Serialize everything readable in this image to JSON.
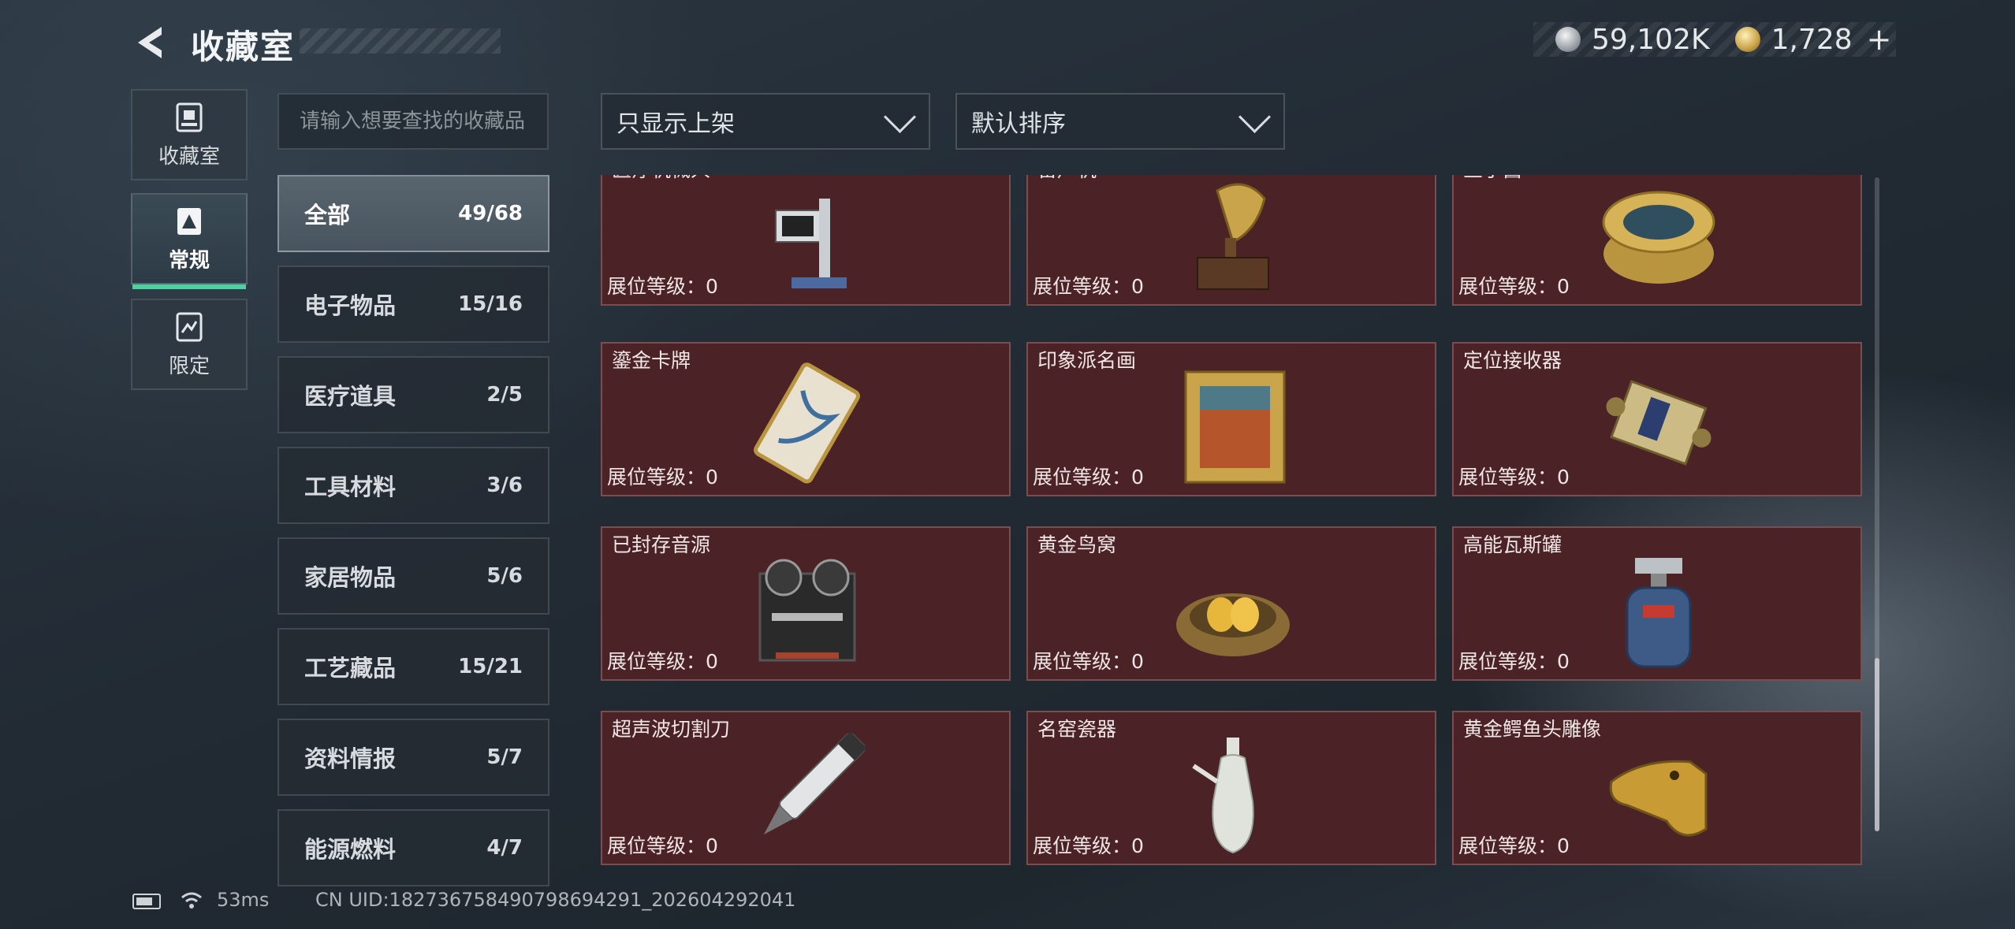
{
  "header": {
    "title": "收藏室"
  },
  "currency": [
    {
      "icon": "silver-coin-icon",
      "value": "59,102K"
    },
    {
      "icon": "gold-coin-icon",
      "value": "1,728"
    }
  ],
  "side_tabs": [
    {
      "label": "收藏室",
      "icon": "collection-room-icon",
      "active": false
    },
    {
      "label": "常规",
      "icon": "regular-icon",
      "active": true
    },
    {
      "label": "限定",
      "icon": "limited-icon",
      "active": false
    }
  ],
  "search": {
    "placeholder": "请输入想要查找的收藏品",
    "value": ""
  },
  "filters": {
    "display_label": "只显示上架",
    "sort_label": "默认排序"
  },
  "categories": [
    {
      "name": "全部",
      "count": "49/68",
      "active": true
    },
    {
      "name": "电子物品",
      "count": "15/16"
    },
    {
      "name": "医疗道具",
      "count": "2/5"
    },
    {
      "name": "工具材料",
      "count": "3/6"
    },
    {
      "name": "家居物品",
      "count": "5/6"
    },
    {
      "name": "工艺藏品",
      "count": "15/21"
    },
    {
      "name": "资料情报",
      "count": "5/7"
    },
    {
      "name": "能源燃料",
      "count": "4/7"
    }
  ],
  "items": [
    {
      "name": "医疗机械人",
      "level_label": "展位等级：",
      "level": "0",
      "icon": "medical-robot-icon"
    },
    {
      "name": "留声机",
      "level_label": "展位等级：",
      "level": "0",
      "icon": "gramophone-icon"
    },
    {
      "name": "鱼子酱",
      "level_label": "展位等级：",
      "level": "0",
      "icon": "caviar-tin-icon"
    },
    {
      "name": "鎏金卡牌",
      "level_label": "展位等级：",
      "level": "0",
      "icon": "gilded-card-icon"
    },
    {
      "name": "印象派名画",
      "level_label": "展位等级：",
      "level": "0",
      "icon": "painting-icon"
    },
    {
      "name": "定位接收器",
      "level_label": "展位等级：",
      "level": "0",
      "icon": "receiver-icon"
    },
    {
      "name": "已封存音源",
      "level_label": "展位等级：",
      "level": "0",
      "icon": "reel-recorder-icon"
    },
    {
      "name": "黄金鸟窝",
      "level_label": "展位等级：",
      "level": "0",
      "icon": "golden-nest-icon"
    },
    {
      "name": "高能瓦斯罐",
      "level_label": "展位等级：",
      "level": "0",
      "icon": "gas-canister-icon"
    },
    {
      "name": "超声波切割刀",
      "level_label": "展位等级：",
      "level": "0",
      "icon": "ultrasonic-cutter-icon"
    },
    {
      "name": "名窑瓷器",
      "level_label": "展位等级：",
      "level": "0",
      "icon": "porcelain-vase-icon"
    },
    {
      "name": "黄金鳄鱼头雕像",
      "level_label": "展位等级：",
      "level": "0",
      "icon": "golden-crocodile-head-icon"
    }
  ],
  "status": {
    "ping": "53ms",
    "uid": "CN UID:182736758490798694291_202604292041"
  },
  "colors": {
    "card_bg": "#4b2226",
    "accent_underline": "#49d3a0",
    "panel_bg": "#242c34"
  }
}
